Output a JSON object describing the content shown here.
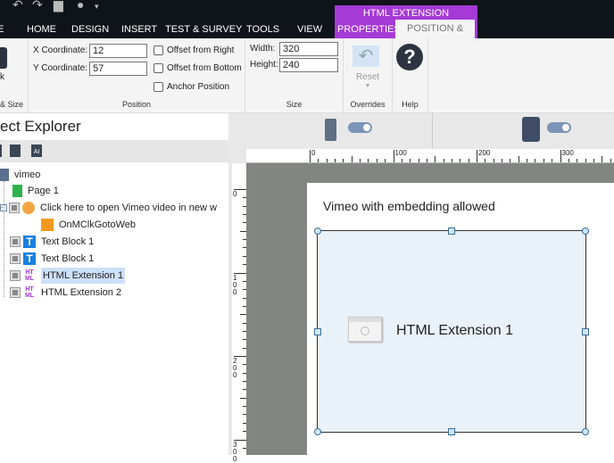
{
  "ribbon_tabs": [
    "HOME",
    "DESIGN",
    "INSERT",
    "TEST & SURVEY",
    "TOOLS",
    "VIEW"
  ],
  "context": {
    "title": "HTML EXTENSION",
    "tabs": [
      "PROPERTIES",
      "POSITION & SIZE"
    ],
    "active": "POSITION & SIZE",
    "color": "#a53ad6"
  },
  "position": {
    "x_label": "X Coordinate:",
    "x_value": "12",
    "y_label": "Y Coordinate:",
    "y_value": "57",
    "offset_right": "Offset from Right",
    "offset_bottom": "Offset from Bottom",
    "anchor": "Anchor Position",
    "group": "Position"
  },
  "size": {
    "width_label": "Width:",
    "width_value": "320",
    "height_label": "Height:",
    "height_value": "240",
    "group": "Size"
  },
  "overrides": {
    "reset": "Reset",
    "group": "Overrides"
  },
  "help": {
    "group": "Help"
  },
  "left_group": {
    "partial_label": "k",
    "group": "& Size"
  },
  "explorer": {
    "title": "ect Explorer",
    "items": [
      {
        "label": "vimeo"
      },
      {
        "label": "Page 1"
      },
      {
        "label": "Click here to open Vimeo video in new w"
      },
      {
        "label": "OnMClkGotoWeb"
      },
      {
        "label": "Text Block 1"
      },
      {
        "label": "Text Block 1"
      },
      {
        "label": "HTML Extension 1",
        "selected": true
      },
      {
        "label": "HTML Extension 2"
      }
    ]
  },
  "ruler": {
    "h": [
      "0",
      "100",
      "200",
      "300"
    ],
    "v": [
      "0",
      "100",
      "200",
      "300"
    ]
  },
  "canvas": {
    "heading": "Vimeo with embedding allowed",
    "widget_label": "HTML Extension 1"
  }
}
